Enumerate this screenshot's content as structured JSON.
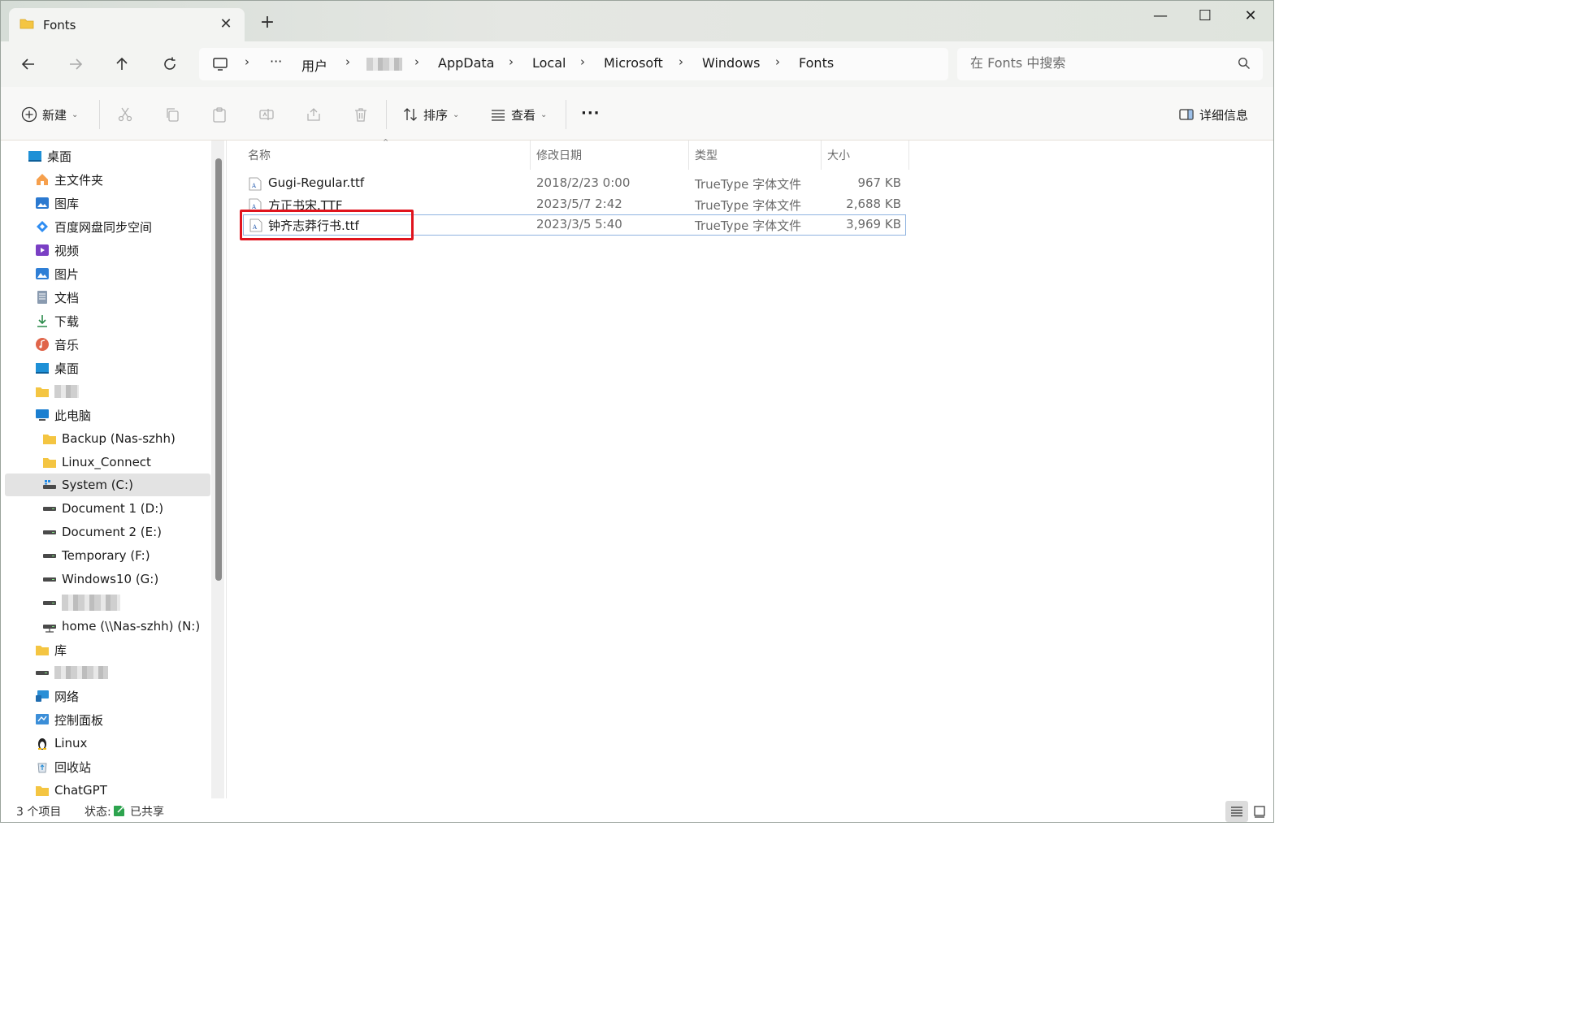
{
  "window": {
    "tab_title": "Fonts",
    "new_tab_symbol": "+",
    "close_tab_symbol": "✕",
    "controls": {
      "minimize": "—",
      "maximize": "☐",
      "close": "✕"
    }
  },
  "address_bar": {
    "breadcrumb": [
      "用户",
      "AppData",
      "Local",
      "Microsoft",
      "Windows",
      "Fonts"
    ],
    "ellipsis": "···",
    "search_placeholder": "在 Fonts 中搜索"
  },
  "toolbar": {
    "new_label": "新建",
    "sort_label": "排序",
    "view_label": "查看",
    "more_label": "···",
    "details_label": "详细信息"
  },
  "sidebar": {
    "items": [
      {
        "label": "桌面",
        "icon": "desktop-icon"
      },
      {
        "label": "主文件夹",
        "icon": "home-icon"
      },
      {
        "label": "图库",
        "icon": "gallery-icon"
      },
      {
        "label": "百度网盘同步空间",
        "icon": "baidu-netdisk-icon"
      },
      {
        "label": "视频",
        "icon": "video-icon"
      },
      {
        "label": "图片",
        "icon": "pictures-icon"
      },
      {
        "label": "文档",
        "icon": "documents-icon"
      },
      {
        "label": "下载",
        "icon": "download-icon"
      },
      {
        "label": "音乐",
        "icon": "music-icon"
      },
      {
        "label": "桌面",
        "icon": "desktop-icon"
      },
      {
        "label": "",
        "icon": "folder-icon"
      },
      {
        "label": "此电脑",
        "icon": "this-pc-icon"
      },
      {
        "label": "Backup (Nas-szhh)",
        "icon": "folder-icon"
      },
      {
        "label": "Linux_Connect",
        "icon": "folder-icon"
      },
      {
        "label": "System (C:)",
        "icon": "system-drive-icon"
      },
      {
        "label": "Document 1 (D:)",
        "icon": "drive-icon"
      },
      {
        "label": "Document 2 (E:)",
        "icon": "drive-icon"
      },
      {
        "label": "Temporary (F:)",
        "icon": "drive-icon"
      },
      {
        "label": "Windows10 (G:)",
        "icon": "drive-icon"
      },
      {
        "label": "",
        "icon": "drive-icon"
      },
      {
        "label": "home (\\\\Nas-szhh) (N:)",
        "icon": "network-drive-icon"
      },
      {
        "label": "库",
        "icon": "folder-icon"
      },
      {
        "label": "",
        "icon": "drive-icon"
      },
      {
        "label": "网络",
        "icon": "network-icon"
      },
      {
        "label": "控制面板",
        "icon": "control-panel-icon"
      },
      {
        "label": "Linux",
        "icon": "linux-icon"
      },
      {
        "label": "回收站",
        "icon": "recycle-bin-icon"
      },
      {
        "label": "ChatGPT",
        "icon": "folder-icon"
      }
    ]
  },
  "file_list": {
    "columns": [
      "名称",
      "修改日期",
      "类型",
      "大小"
    ],
    "rows": [
      {
        "name": "Gugi-Regular.ttf",
        "modified": "2018/2/23 0:00",
        "type": "TrueType 字体文件",
        "size": "967 KB"
      },
      {
        "name": "方正书宋.TTF",
        "modified": "2023/5/7 2:42",
        "type": "TrueType 字体文件",
        "size": "2,688 KB"
      },
      {
        "name": "钟齐志莽行书.ttf",
        "modified": "2023/3/5 5:40",
        "type": "TrueType 字体文件",
        "size": "3,969 KB"
      }
    ]
  },
  "status_bar": {
    "item_count": "3 个项目",
    "status_label": "状态:",
    "status_value": "已共享"
  },
  "colors": {
    "highlight_box": "#e0141e",
    "selection_border": "#8fb3e0",
    "folder": "#f4c542"
  }
}
